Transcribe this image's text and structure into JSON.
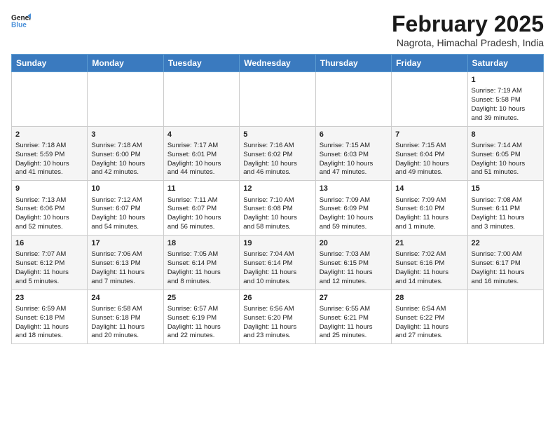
{
  "header": {
    "logo_line1": "General",
    "logo_line2": "Blue",
    "title": "February 2025",
    "subtitle": "Nagrota, Himachal Pradesh, India"
  },
  "days_of_week": [
    "Sunday",
    "Monday",
    "Tuesday",
    "Wednesday",
    "Thursday",
    "Friday",
    "Saturday"
  ],
  "weeks": [
    {
      "days": [
        {
          "num": "",
          "info": ""
        },
        {
          "num": "",
          "info": ""
        },
        {
          "num": "",
          "info": ""
        },
        {
          "num": "",
          "info": ""
        },
        {
          "num": "",
          "info": ""
        },
        {
          "num": "",
          "info": ""
        },
        {
          "num": "1",
          "info": "Sunrise: 7:19 AM\nSunset: 5:58 PM\nDaylight: 10 hours\nand 39 minutes."
        }
      ]
    },
    {
      "days": [
        {
          "num": "2",
          "info": "Sunrise: 7:18 AM\nSunset: 5:59 PM\nDaylight: 10 hours\nand 41 minutes."
        },
        {
          "num": "3",
          "info": "Sunrise: 7:18 AM\nSunset: 6:00 PM\nDaylight: 10 hours\nand 42 minutes."
        },
        {
          "num": "4",
          "info": "Sunrise: 7:17 AM\nSunset: 6:01 PM\nDaylight: 10 hours\nand 44 minutes."
        },
        {
          "num": "5",
          "info": "Sunrise: 7:16 AM\nSunset: 6:02 PM\nDaylight: 10 hours\nand 46 minutes."
        },
        {
          "num": "6",
          "info": "Sunrise: 7:15 AM\nSunset: 6:03 PM\nDaylight: 10 hours\nand 47 minutes."
        },
        {
          "num": "7",
          "info": "Sunrise: 7:15 AM\nSunset: 6:04 PM\nDaylight: 10 hours\nand 49 minutes."
        },
        {
          "num": "8",
          "info": "Sunrise: 7:14 AM\nSunset: 6:05 PM\nDaylight: 10 hours\nand 51 minutes."
        }
      ]
    },
    {
      "days": [
        {
          "num": "9",
          "info": "Sunrise: 7:13 AM\nSunset: 6:06 PM\nDaylight: 10 hours\nand 52 minutes."
        },
        {
          "num": "10",
          "info": "Sunrise: 7:12 AM\nSunset: 6:07 PM\nDaylight: 10 hours\nand 54 minutes."
        },
        {
          "num": "11",
          "info": "Sunrise: 7:11 AM\nSunset: 6:07 PM\nDaylight: 10 hours\nand 56 minutes."
        },
        {
          "num": "12",
          "info": "Sunrise: 7:10 AM\nSunset: 6:08 PM\nDaylight: 10 hours\nand 58 minutes."
        },
        {
          "num": "13",
          "info": "Sunrise: 7:09 AM\nSunset: 6:09 PM\nDaylight: 10 hours\nand 59 minutes."
        },
        {
          "num": "14",
          "info": "Sunrise: 7:09 AM\nSunset: 6:10 PM\nDaylight: 11 hours\nand 1 minute."
        },
        {
          "num": "15",
          "info": "Sunrise: 7:08 AM\nSunset: 6:11 PM\nDaylight: 11 hours\nand 3 minutes."
        }
      ]
    },
    {
      "days": [
        {
          "num": "16",
          "info": "Sunrise: 7:07 AM\nSunset: 6:12 PM\nDaylight: 11 hours\nand 5 minutes."
        },
        {
          "num": "17",
          "info": "Sunrise: 7:06 AM\nSunset: 6:13 PM\nDaylight: 11 hours\nand 7 minutes."
        },
        {
          "num": "18",
          "info": "Sunrise: 7:05 AM\nSunset: 6:14 PM\nDaylight: 11 hours\nand 8 minutes."
        },
        {
          "num": "19",
          "info": "Sunrise: 7:04 AM\nSunset: 6:14 PM\nDaylight: 11 hours\nand 10 minutes."
        },
        {
          "num": "20",
          "info": "Sunrise: 7:03 AM\nSunset: 6:15 PM\nDaylight: 11 hours\nand 12 minutes."
        },
        {
          "num": "21",
          "info": "Sunrise: 7:02 AM\nSunset: 6:16 PM\nDaylight: 11 hours\nand 14 minutes."
        },
        {
          "num": "22",
          "info": "Sunrise: 7:00 AM\nSunset: 6:17 PM\nDaylight: 11 hours\nand 16 minutes."
        }
      ]
    },
    {
      "days": [
        {
          "num": "23",
          "info": "Sunrise: 6:59 AM\nSunset: 6:18 PM\nDaylight: 11 hours\nand 18 minutes."
        },
        {
          "num": "24",
          "info": "Sunrise: 6:58 AM\nSunset: 6:18 PM\nDaylight: 11 hours\nand 20 minutes."
        },
        {
          "num": "25",
          "info": "Sunrise: 6:57 AM\nSunset: 6:19 PM\nDaylight: 11 hours\nand 22 minutes."
        },
        {
          "num": "26",
          "info": "Sunrise: 6:56 AM\nSunset: 6:20 PM\nDaylight: 11 hours\nand 23 minutes."
        },
        {
          "num": "27",
          "info": "Sunrise: 6:55 AM\nSunset: 6:21 PM\nDaylight: 11 hours\nand 25 minutes."
        },
        {
          "num": "28",
          "info": "Sunrise: 6:54 AM\nSunset: 6:22 PM\nDaylight: 11 hours\nand 27 minutes."
        },
        {
          "num": "",
          "info": ""
        }
      ]
    }
  ]
}
